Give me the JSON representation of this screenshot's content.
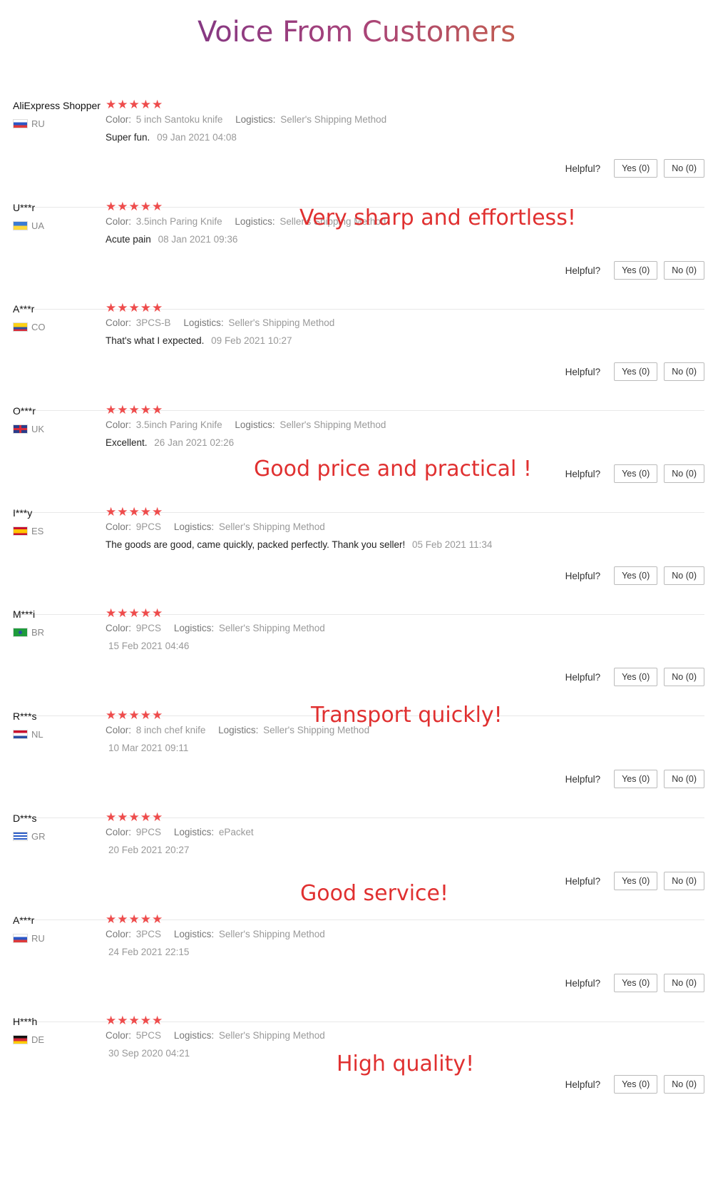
{
  "page": {
    "title": "Voice From Customers",
    "labels": {
      "color": "Color:",
      "logistics": "Logistics:",
      "helpful": "Helpful?"
    },
    "accent_star": "#ee4c4c",
    "callout_color": "#e03030"
  },
  "reviews": [
    {
      "user": "AliExpress Shopper",
      "country": "RU",
      "flag": "ru-flag-icon",
      "color": "5 inch Santoku knife",
      "logistics": "Seller's Shipping Method",
      "text": "Super fun.",
      "date": "09 Jan 2021 04:08",
      "rating": 5,
      "yes": "Yes (0)",
      "no": "No (0)"
    },
    {
      "user": "U***r",
      "country": "UA",
      "flag": "ua-flag-icon",
      "color": "3.5inch Paring Knife",
      "logistics": "Seller's Shipping Method",
      "text": "Acute pain",
      "date": "08 Jan 2021 09:36",
      "rating": 5,
      "yes": "Yes (0)",
      "no": "No (0)"
    },
    {
      "user": "A***r",
      "country": "CO",
      "flag": "co-flag-icon",
      "color": "3PCS-B",
      "logistics": "Seller's Shipping Method",
      "text": "That's what I expected.",
      "date": "09 Feb 2021 10:27",
      "rating": 5,
      "yes": "Yes (0)",
      "no": "No (0)"
    },
    {
      "user": "O***r",
      "country": "UK",
      "flag": "uk-flag-icon",
      "color": "3.5inch Paring Knife",
      "logistics": "Seller's Shipping Method",
      "text": "Excellent.",
      "date": "26 Jan 2021 02:26",
      "rating": 5,
      "yes": "Yes (0)",
      "no": "No (0)"
    },
    {
      "user": "I***y",
      "country": "ES",
      "flag": "es-flag-icon",
      "color": "9PCS",
      "logistics": "Seller's Shipping Method",
      "text": "The goods are good, came quickly, packed perfectly. Thank you seller!",
      "date": "05 Feb 2021 11:34",
      "rating": 5,
      "yes": "Yes (0)",
      "no": "No (0)"
    },
    {
      "user": "M***i",
      "country": "BR",
      "flag": "br-flag-icon",
      "color": "9PCS",
      "logistics": "Seller's Shipping Method",
      "text": "",
      "date": "15 Feb 2021 04:46",
      "rating": 5,
      "yes": "Yes (0)",
      "no": "No (0)"
    },
    {
      "user": "R***s",
      "country": "NL",
      "flag": "nl-flag-icon",
      "color": "8 inch chef knife",
      "logistics": "Seller's Shipping Method",
      "text": "",
      "date": "10 Mar 2021 09:11",
      "rating": 5,
      "yes": "Yes (0)",
      "no": "No (0)"
    },
    {
      "user": "D***s",
      "country": "GR",
      "flag": "gr-flag-icon",
      "color": "9PCS",
      "logistics": "ePacket",
      "text": "",
      "date": "20 Feb 2021 20:27",
      "rating": 5,
      "yes": "Yes (0)",
      "no": "No (0)"
    },
    {
      "user": "A***r",
      "country": "RU",
      "flag": "ru-flag-icon",
      "color": "3PCS",
      "logistics": "Seller's Shipping Method",
      "text": "",
      "date": "24 Feb 2021 22:15",
      "rating": 5,
      "yes": "Yes (0)",
      "no": "No (0)"
    },
    {
      "user": "H***h",
      "country": "DE",
      "flag": "de-flag-icon",
      "color": "5PCS",
      "logistics": "Seller's Shipping Method",
      "text": "",
      "date": "30 Sep 2020 04:21",
      "rating": 5,
      "yes": "Yes (0)",
      "no": "No (0)"
    }
  ],
  "callouts": [
    "Very sharp and effortless!",
    "Good price and practical !",
    "Transport quickly!",
    "Good service!",
    "High quality!"
  ]
}
